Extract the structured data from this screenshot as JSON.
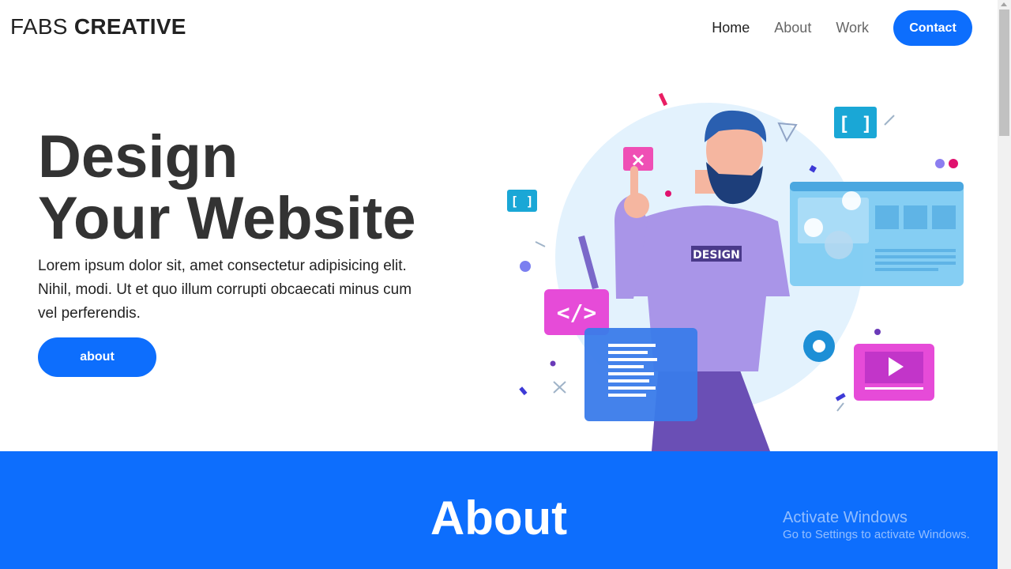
{
  "header": {
    "logo_light": "FABS",
    "logo_bold": "CREATIVE",
    "nav": [
      {
        "label": "Home"
      },
      {
        "label": "About"
      },
      {
        "label": "Work"
      }
    ],
    "contact_label": "Contact"
  },
  "hero": {
    "title_line1": "Design",
    "title_line2": "Your Website",
    "text": "Lorem ipsum dolor sit, amet consectetur adipisicing elit. Nihil, modi. Ut et quo illum corrupti obcaecati minus cum vel perferendis.",
    "button_label": "about",
    "illustration": {
      "shirt_text": "DESIGN",
      "code_bracket_icon": "[ ]",
      "code_tag_icon": "</>",
      "close_icon": "×"
    }
  },
  "about": {
    "title": "About"
  },
  "watermark": {
    "title": "Activate Windows",
    "subtitle": "Go to Settings to activate Windows."
  },
  "colors": {
    "primary": "#0d6efd",
    "text_dark": "#333333"
  }
}
